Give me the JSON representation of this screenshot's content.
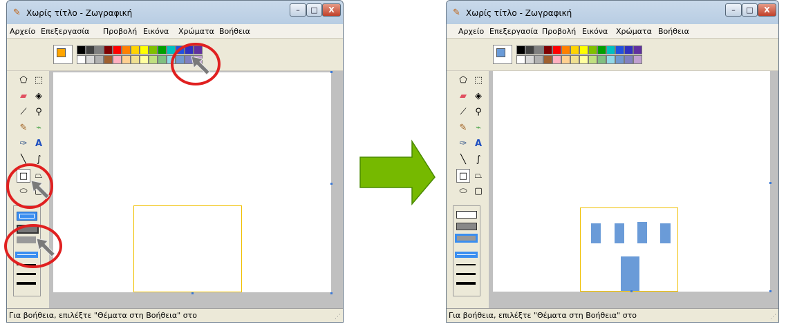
{
  "title": "Χωρίς τίτλο - Ζωγραφική",
  "window_controls": {
    "minimize": "–",
    "maximize": "□",
    "close": "X"
  },
  "menu": [
    "Αρχείο",
    "Επεξεργασία",
    "Προβολή",
    "Εικόνα",
    "Χρώματα",
    "Βοήθεια"
  ],
  "status_text": "Για βοήθεια, επιλέξτε \"Θέματα στη Βοήθεια\" στο",
  "palette": {
    "top_row": [
      "#000000",
      "#404040",
      "#808080",
      "#800000",
      "#ff0000",
      "#ff8000",
      "#ffd400",
      "#ffff00",
      "#80c000",
      "#00a000",
      "#00c0c0",
      "#2050e0",
      "#3030c0",
      "#6030a0"
    ],
    "bottom_row": [
      "#ffffff",
      "#d8d8d8",
      "#b0b0b0",
      "#a06030",
      "#ffb0c0",
      "#ffd090",
      "#f0e090",
      "#ffffa0",
      "#c0e080",
      "#80c080",
      "#90d8e8",
      "#7098d0",
      "#8080c0",
      "#c0a0d0"
    ]
  },
  "before": {
    "fg_color": "#ffa500"
  },
  "after": {
    "fg_color": "#6a9bd8",
    "building_color": "#6a9bd8"
  },
  "tools": [
    "free-select",
    "rect-select",
    "eraser",
    "fill",
    "color-picker",
    "magnifier",
    "pencil",
    "brush",
    "airbrush",
    "text",
    "line",
    "curve",
    "rectangle",
    "polygon",
    "ellipse",
    "rounded-rect"
  ],
  "arrow_color": "#76b900",
  "annotation_color": "#e02020"
}
